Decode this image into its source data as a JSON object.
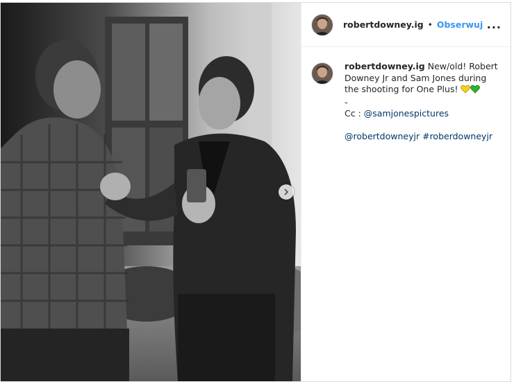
{
  "post": {
    "username": "robertdowney.ig",
    "separator": "•",
    "follow_label": "Obserwuj",
    "more_label": "...",
    "caption_username": "robertdowney.ig",
    "caption_line1": "New/old! Robert Downey Jr and Sam Jones during the shooting for One Plus!",
    "emoji_1": "yellow-heart-icon",
    "emoji_2": "green-heart-icon",
    "dash": "-",
    "cc_label": "Cc : ",
    "cc_mention": "@samjonespictures",
    "mention_1": "@robertdowneyjr",
    "hashtag_1": "#roberdowneyjr"
  },
  "colors": {
    "follow_blue": "#3897f0",
    "link_navy": "#003569",
    "yellow_heart": "#f7d21a",
    "green_heart": "#2cb52c"
  }
}
